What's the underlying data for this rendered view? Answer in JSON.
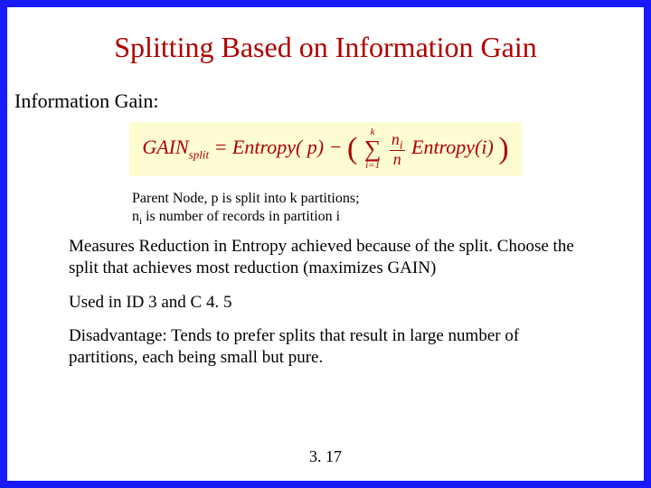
{
  "title": "Splitting Based on Information Gain",
  "subhead": "Information Gain:",
  "formula": {
    "lhs_main": "GAIN",
    "lhs_sub": "split",
    "eq": " = ",
    "entropy": "Entropy",
    "p_arg": "( p)",
    "minus": " − ",
    "lparen": "(",
    "rparen": ")",
    "sum_top": "k",
    "sum_bot": "i=1",
    "frac_num_sym": "n",
    "frac_num_sub": "i",
    "frac_den": "n",
    "i_arg": "(i)"
  },
  "notes": {
    "line1": "Parent Node, p is split into k partitions;",
    "line2_pre": "n",
    "line2_sub": "i",
    "line2_post": " is number of records in partition i"
  },
  "body": {
    "p1": "Measures Reduction in Entropy achieved because of the split. Choose the split that achieves most reduction (maximizes GAIN)",
    "p2": "Used in ID 3 and C 4. 5",
    "p3": "Disadvantage: Tends to prefer splits that result in large number of partitions, each being small but pure."
  },
  "page": "3. 17"
}
